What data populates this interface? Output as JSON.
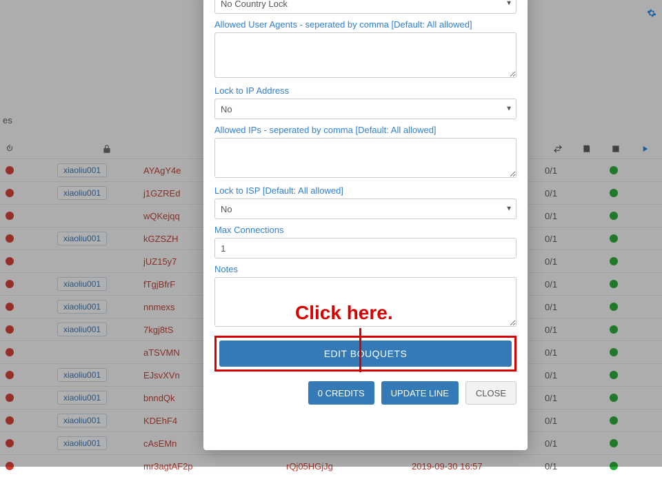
{
  "sidebar": {
    "label_fragment": "es"
  },
  "table": {
    "ratio": "0/1",
    "rows": [
      {
        "owner": "xiaoliu001",
        "user": "AYAgY4e"
      },
      {
        "owner": "xiaoliu001",
        "user": "j1GZREd"
      },
      {
        "owner": "",
        "user": "wQKejqq"
      },
      {
        "owner": "xiaoliu001",
        "user": "kGZSZH"
      },
      {
        "owner": "",
        "user": "jUZ15y7"
      },
      {
        "owner": "xiaoliu001",
        "user": "fTgjBfrF"
      },
      {
        "owner": "xiaoliu001",
        "user": "nnmexs"
      },
      {
        "owner": "xiaoliu001",
        "user": "7kgj8tS"
      },
      {
        "owner": "",
        "user": "aTSVMN"
      },
      {
        "owner": "xiaoliu001",
        "user": "EJsvXVn"
      },
      {
        "owner": "xiaoliu001",
        "user": "bnndQk"
      },
      {
        "owner": "xiaoliu001",
        "user": "KDEhF4"
      },
      {
        "owner": "xiaoliu001",
        "user": "cAsEMn"
      },
      {
        "owner": "",
        "user": "mr3agtAF2p",
        "user2": "rQj05HGjJg",
        "date": "2019-09-30 16:57"
      }
    ]
  },
  "modal": {
    "country_lock": {
      "value": "No Country Lock"
    },
    "user_agents": {
      "label": "Allowed User Agents - seperated by comma [Default: All allowed]",
      "value": ""
    },
    "lock_ip": {
      "label": "Lock to IP Address",
      "value": "No"
    },
    "allowed_ips": {
      "label": "Allowed IPs - seperated by comma [Default: All allowed]",
      "value": ""
    },
    "lock_isp": {
      "label": "Lock to ISP [Default: All allowed]",
      "value": "No"
    },
    "max_conn": {
      "label": "Max Connections",
      "value": "1"
    },
    "notes": {
      "label": "Notes",
      "value": ""
    },
    "edit_bouquets_label": "EDIT BOUQUETS",
    "footer": {
      "credits": "0 CREDITS",
      "update": "UPDATE LINE",
      "close": "CLOSE"
    }
  },
  "annotation": {
    "text": "Click here."
  }
}
